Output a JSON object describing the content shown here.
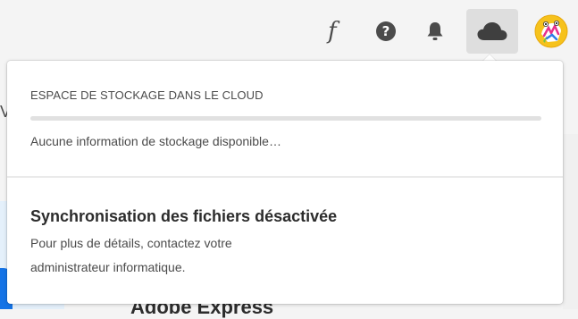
{
  "header": {
    "fonts_icon": "fonts-icon",
    "help_icon": "help-icon",
    "bell_icon": "notifications-bell-icon",
    "cloud_icon": "cloud-storage-icon",
    "avatar_icon": "user-avatar-icon"
  },
  "background_page": {
    "left_letter": "V",
    "card_title": "Adobe Express"
  },
  "cloud_popover": {
    "section_heading": "ESPACE DE STOCKAGE DANS LE CLOUD",
    "storage_used_fraction": 0,
    "storage_status": "Aucune information de stockage disponible…",
    "sync_title": "Synchronisation des fichiers désactivée",
    "sync_message_line1": "Pour plus de détails, contactez votre",
    "sync_message_line2": "administrateur informatique."
  },
  "colors": {
    "accent": "#1473e6",
    "header_bg": "#f4f4f4",
    "active_button_bg": "#dedede"
  }
}
